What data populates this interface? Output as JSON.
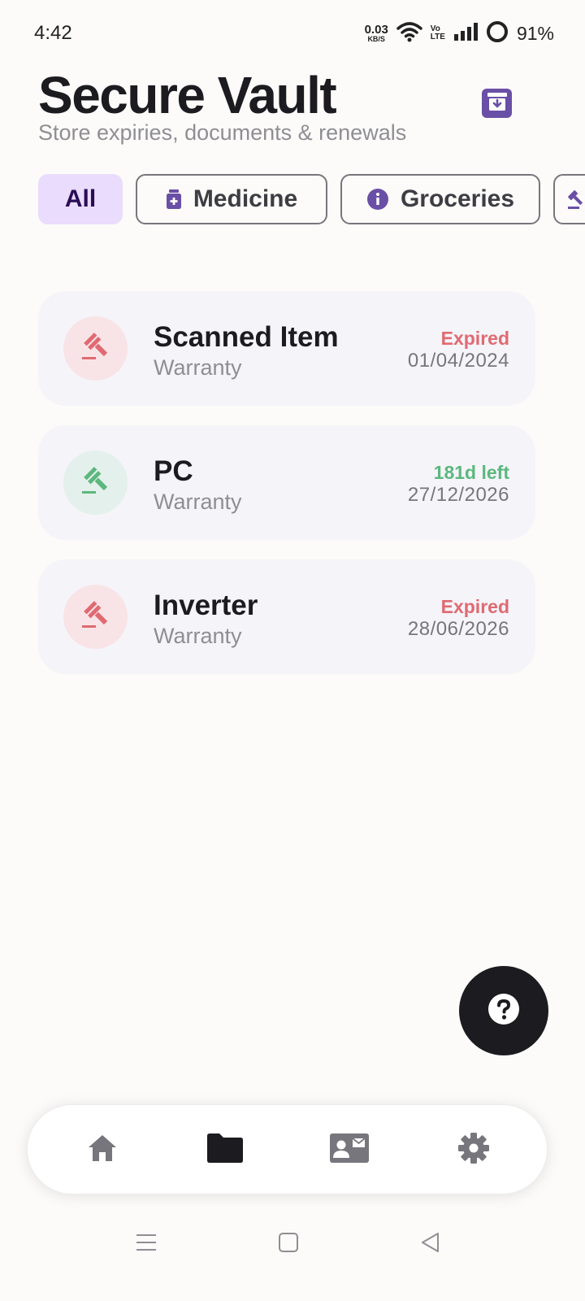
{
  "status_bar": {
    "time": "4:42",
    "net_speed_value": "0.03",
    "net_speed_unit": "KB/S",
    "volte_top": "Vo",
    "volte_bottom": "LTE",
    "battery_percent": "91%"
  },
  "header": {
    "title": "Secure Vault",
    "subtitle": "Store expiries, documents & renewals",
    "archive_icon": "archive-icon"
  },
  "filters": [
    {
      "label": "All",
      "icon": "",
      "active": true
    },
    {
      "label": "Medicine",
      "icon": "medicine-icon",
      "active": false
    },
    {
      "label": "Groceries",
      "icon": "info-icon",
      "active": false
    },
    {
      "label": "",
      "icon": "gavel-icon",
      "active": false
    }
  ],
  "items": [
    {
      "title": "Scanned Item",
      "category": "Warranty",
      "status": "Expired",
      "date": "01/04/2024",
      "status_color": "#e06a72",
      "icon": "gavel-icon"
    },
    {
      "title": "PC",
      "category": "Warranty",
      "status": "181d left",
      "date": "27/12/2026",
      "status_color": "#5cb87e",
      "icon": "gavel-icon"
    },
    {
      "title": "Inverter",
      "category": "Warranty",
      "status": "Expired",
      "date": "28/06/2026",
      "status_color": "#e06a72",
      "icon": "gavel-icon"
    }
  ],
  "fab": {
    "icon": "help-icon"
  },
  "bottom_nav": [
    {
      "icon": "home-icon",
      "active": false
    },
    {
      "icon": "folder-icon",
      "active": true
    },
    {
      "icon": "contact-card-icon",
      "active": false
    },
    {
      "icon": "settings-icon",
      "active": false
    }
  ],
  "colors": {
    "accent": "#6a4fa6",
    "chip_active_bg": "#eadcfc",
    "expired": "#e06a72",
    "ok": "#5cb87e"
  }
}
